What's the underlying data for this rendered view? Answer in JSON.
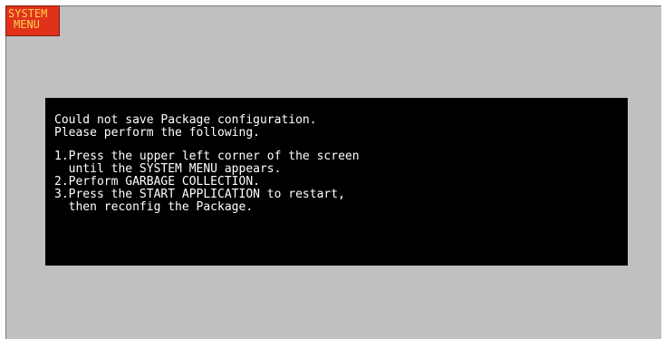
{
  "system_menu": {
    "line1": "SYSTEM",
    "line2": "MENU"
  },
  "message": {
    "line1": "Could not save Package configuration.",
    "line2": "Please perform the following.",
    "step1_line1": "1.Press the upper left corner of the screen",
    "step1_line2": "  until the SYSTEM MENU appears.",
    "step2_line1": "2.Perform GARBAGE COLLECTION.",
    "step3_line1": "3.Press the START APPLICATION to restart,",
    "step3_line2": "  then reconfig the Package."
  },
  "colors": {
    "background": "#c0c0c0",
    "system_menu_bg": "#e2311b",
    "system_menu_text": "#ffd24a",
    "message_bg": "#000000",
    "message_text": "#ffffff"
  }
}
